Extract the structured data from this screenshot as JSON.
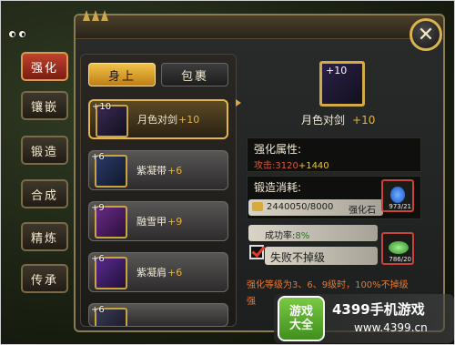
{
  "tabs": [
    {
      "label": "强化",
      "active": true
    },
    {
      "label": "镶嵌",
      "active": false
    },
    {
      "label": "锻造",
      "active": false
    },
    {
      "label": "合成",
      "active": false
    },
    {
      "label": "精炼",
      "active": false
    },
    {
      "label": "传承",
      "active": false
    }
  ],
  "segments": {
    "on_body": "身上",
    "bag": "包裹"
  },
  "items": [
    {
      "badge": "+10",
      "name": "月色对剑",
      "level": "+10",
      "selected": true,
      "icon": "twin-swords-icon"
    },
    {
      "badge": "+6",
      "name": "紫凝带",
      "level": "+6",
      "selected": false,
      "icon": "belt-icon"
    },
    {
      "badge": "+9",
      "name": "融雪甲",
      "level": "+9",
      "selected": false,
      "icon": "armor-icon"
    },
    {
      "badge": "+6",
      "name": "紫凝肩",
      "level": "+6",
      "selected": false,
      "icon": "shoulder-icon"
    },
    {
      "badge": "+6",
      "name": "",
      "level": "",
      "selected": false,
      "icon": "partial-item-icon"
    }
  ],
  "detail": {
    "badge": "+10",
    "name": "月色对剑",
    "level": "+10",
    "attr_title": "强化属性:",
    "attr_label": "攻击:",
    "attr_value": "3120",
    "attr_bonus": "+1440",
    "cost_title": "锻造消耗:",
    "gold": "2440050/8000",
    "stone_name": "强化石",
    "stone_count": "973/21",
    "rate_label": "成功率:",
    "rate_value": "8%",
    "protect_label": "失败不掉级",
    "protect_count": "786/20",
    "note": "强化等级为3、6、9级时，100%不掉级",
    "note2_partial": "强"
  },
  "watermark": {
    "logo_line1": "游戏",
    "logo_line2": "大全",
    "brand": "4399手机游戏",
    "url": "www.4399.cn"
  },
  "colors": {
    "accent_gold": "#e2b64a",
    "active_tab_red": "#c0412d",
    "bonus_green": "#e0c53f",
    "note_orange": "#e8782f"
  }
}
